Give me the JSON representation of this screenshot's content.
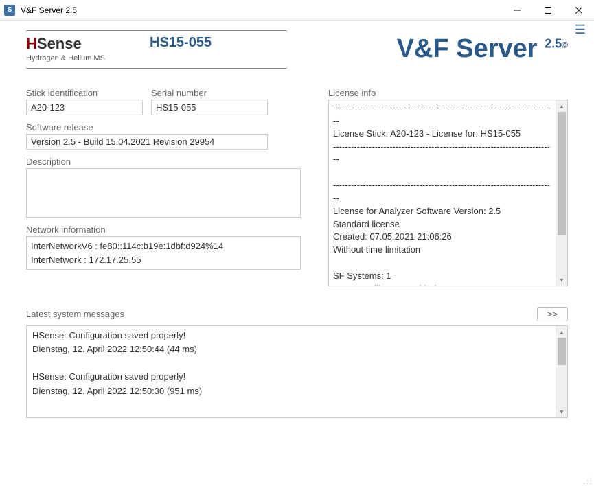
{
  "window": {
    "icon_letter": "S",
    "title": "V&F Server 2.5"
  },
  "header": {
    "logo_name_h": "H",
    "logo_name_rest": "Sense",
    "logo_sub": "Hydrogen & Helium MS",
    "logo_code": "HS15-055",
    "brand_main": "V&F Server",
    "brand_ver": "2.5",
    "brand_copy": "©"
  },
  "fields": {
    "stick_label": "Stick identification",
    "stick_value": "A20-123",
    "serial_label": "Serial number",
    "serial_value": "HS15-055",
    "release_label": "Software release",
    "release_value": "Version 2.5 - Build 15.04.2021 Revision 29954",
    "desc_label": "Description",
    "net_label": "Network information",
    "net_line1": "InterNetworkV6 : fe80::114c:b19e:1dbf:d924%14",
    "net_line2": "InterNetwork : 172.17.25.55"
  },
  "license": {
    "label": "License info",
    "text": "---------------------------------------------------------------------------\nLicense Stick: A20-123 - License for: HS15-055\n---------------------------------------------------------------------------\n\n---------------------------------------------------------------------------\nLicense for Analyzer Software Version: 2.5\nStandard license\nCreated: 07.05.2021 21:06:26\nWithout time limitation\n\nSF Systems: 1\nAccess to library: Enabled\n\nConnect: Not enabled\nAK Interface: Enabled\nWago Interface: Not enabled"
  },
  "messages": {
    "label": "Latest system messages",
    "more_btn": ">>",
    "line1": "HSense: Configuration saved properly!",
    "line2": "Dienstag, 12. April 2022 12:50:44 (44 ms)",
    "line3": "HSense: Configuration saved properly!",
    "line4": "Dienstag, 12. April 2022 12:50:30 (951 ms)"
  }
}
